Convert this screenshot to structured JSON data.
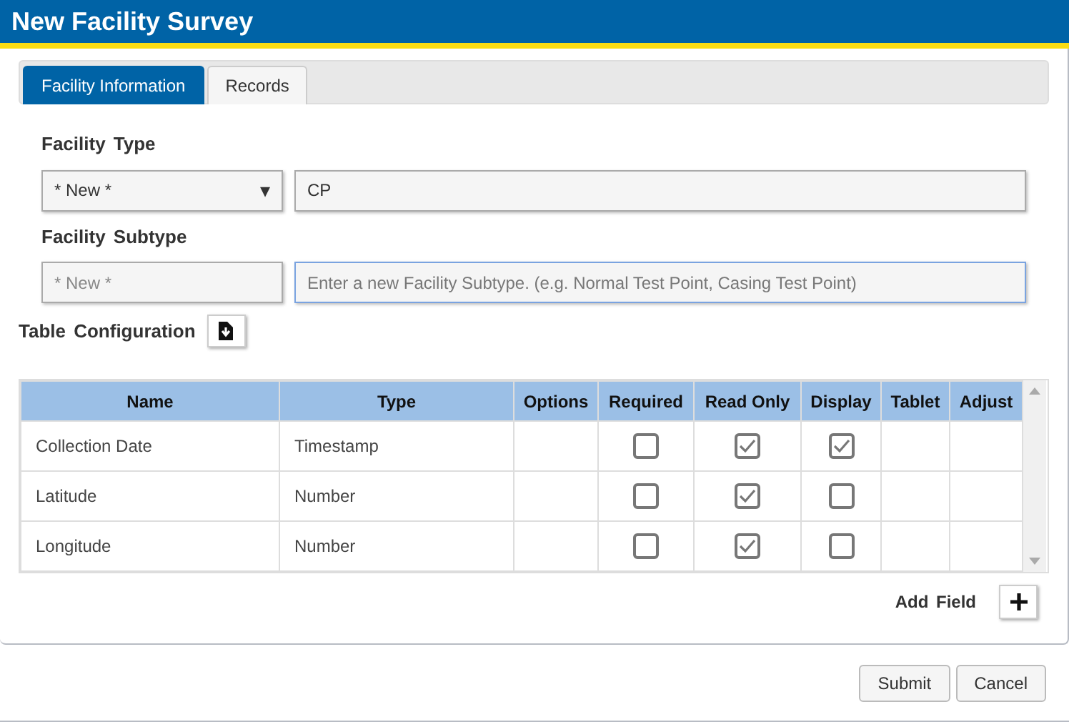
{
  "window": {
    "title": "New Facility Survey"
  },
  "tabs": [
    {
      "label": "Facility Information",
      "selected": true
    },
    {
      "label": "Records",
      "selected": false
    }
  ],
  "facility_type": {
    "label": "Facility Type",
    "select": {
      "value": "* New *",
      "caret": "▾"
    },
    "input": {
      "value": "CP"
    }
  },
  "facility_subtype": {
    "label": "Facility Subtype",
    "select": {
      "value": "* New *",
      "disabled": true
    },
    "input": {
      "placeholder": "Enter a new Facility Subtype. (e.g. Normal Test Point, Casing Test Point)",
      "focused": true
    }
  },
  "table_config": {
    "label": "Table Configuration"
  },
  "table": {
    "columns": [
      "Name",
      "Type",
      "Options",
      "Required",
      "Read Only",
      "Display",
      "Tablet",
      "Adjust"
    ],
    "rows": [
      {
        "name": "Collection Date",
        "type": "Timestamp",
        "required": false,
        "read_only": true,
        "display": true
      },
      {
        "name": "Latitude",
        "type": "Number",
        "required": false,
        "read_only": true,
        "display": false
      },
      {
        "name": "Longitude",
        "type": "Number",
        "required": false,
        "read_only": true,
        "display": false
      }
    ]
  },
  "add_field": {
    "label": "Add Field"
  },
  "buttons": [
    "Submit",
    "Cancel"
  ]
}
